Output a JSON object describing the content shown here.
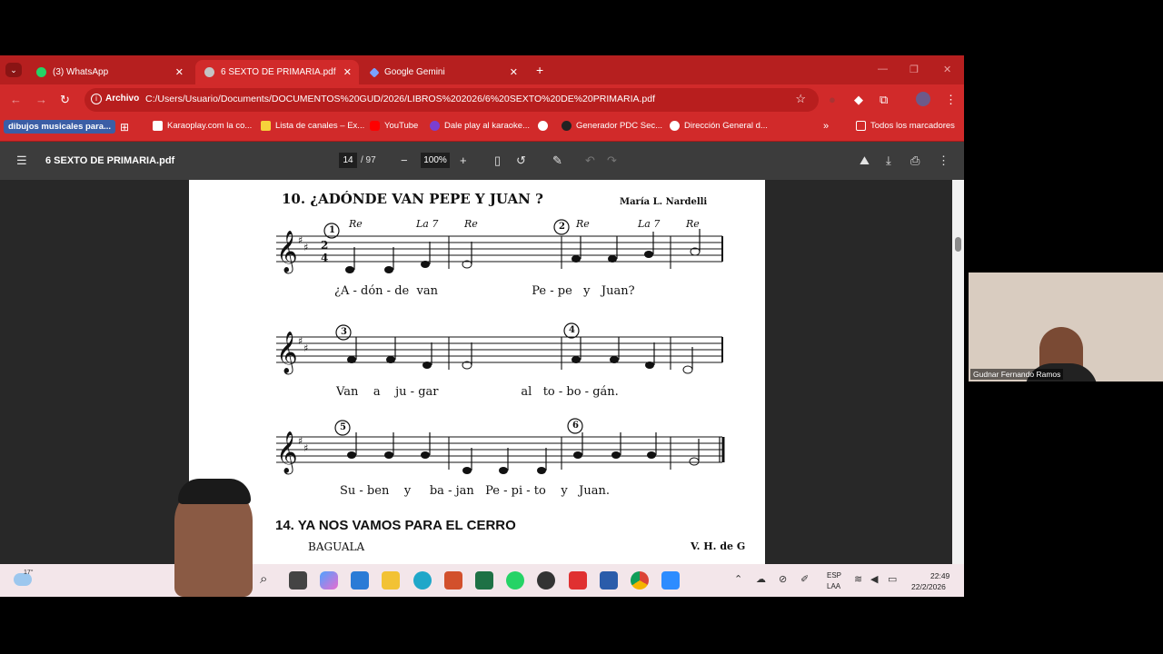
{
  "tabs": [
    {
      "label": "(3) WhatsApp",
      "close": "✕"
    },
    {
      "label": "6 SEXTO DE PRIMARIA.pdf",
      "close": "✕"
    },
    {
      "label": "Google Gemini",
      "close": "✕"
    }
  ],
  "new_tab": "+",
  "omnibox": {
    "chip": "Archivo",
    "url": "C:/Users/Usuario/Documents/DOCUMENTOS%20GUD/2026/LIBROS%202026/6%20SEXTO%20DE%20PRIMARIA.pdf"
  },
  "bookmarks": [
    "dibujos musicales para...",
    "Karaoplay.com la co...",
    "Lista de canales – Ex...",
    "YouTube",
    "Dale play al karaoke...",
    "Generador PDC Sec...",
    "Dirección General d...",
    "Todos los marcadores"
  ],
  "pdf": {
    "title": "6 SEXTO DE PRIMARIA.pdf",
    "page_current": "14",
    "page_total": "/ 97",
    "zoom": "100%"
  },
  "sheet": {
    "song1_title": "10. ¿ADÓNDE VAN PEPE Y JUAN ?",
    "song1_author": "María L. Nardelli",
    "chords_row1": [
      "Re",
      "La 7",
      "Re",
      "Re",
      "La 7",
      "Re"
    ],
    "markers": [
      "1",
      "2",
      "3",
      "4",
      "5",
      "6"
    ],
    "lyrics": [
      "¿A - dón - de  van                         Pe - pe   y   Juan?",
      "Van    a    ju - gar                      al   to - bo - gán.",
      "Su - ben    y     ba - jan   Pe - pi - to    y   Juan."
    ],
    "song2_title": "14. YA NOS VAMOS PARA EL CERRO",
    "song2_subtitle": "BAGUALA",
    "song2_author": "V. H. de G"
  },
  "taskbar": {
    "weather": "17°",
    "lang1": "ESP",
    "lang2": "LAA",
    "time": "22:49",
    "date": "22/2/2026"
  },
  "webcam": {
    "name": "Gudnar Fernando Ramos"
  },
  "colors": {
    "chrome_red": "#d12a2a",
    "tab_strip": "#b61f1f",
    "pdf_toolbar": "#3c3c3c",
    "pdf_bg": "#282828"
  }
}
